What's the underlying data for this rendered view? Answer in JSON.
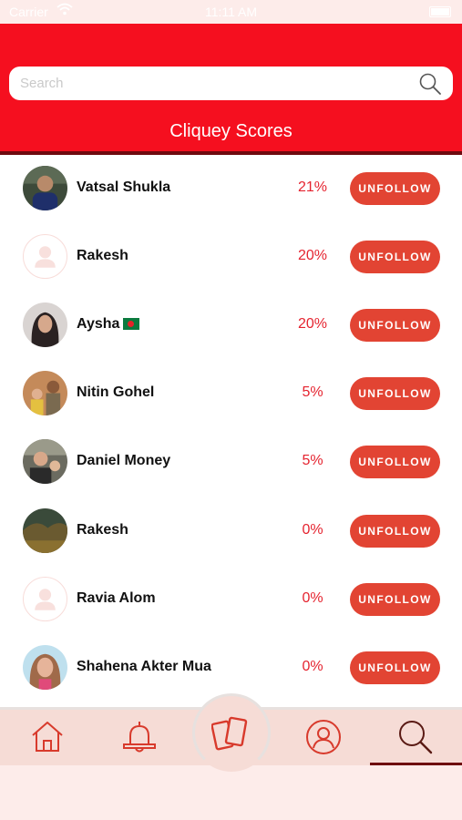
{
  "status_bar": {
    "carrier": "Carrier",
    "time": "11:11 AM"
  },
  "header": {
    "search_placeholder": "Search",
    "title": "Cliquey Scores",
    "color": "#f50f1f"
  },
  "button_color": "#e24433",
  "rows": [
    {
      "name": "Vatsal Shukla",
      "flag": false,
      "percent": "21%",
      "button": "UNFOLLOW",
      "avatar": "photo"
    },
    {
      "name": "Rakesh",
      "flag": false,
      "percent": "20%",
      "button": "UNFOLLOW",
      "avatar": "placeholder"
    },
    {
      "name": "Aysha",
      "flag": true,
      "percent": "20%",
      "button": "UNFOLLOW",
      "avatar": "photo"
    },
    {
      "name": "Nitin Gohel",
      "flag": false,
      "percent": "5%",
      "button": "UNFOLLOW",
      "avatar": "photo"
    },
    {
      "name": "Daniel Money",
      "flag": false,
      "percent": "5%",
      "button": "UNFOLLOW",
      "avatar": "photo"
    },
    {
      "name": "Rakesh",
      "flag": false,
      "percent": "0%",
      "button": "UNFOLLOW",
      "avatar": "photo"
    },
    {
      "name": "Ravia Alom",
      "flag": false,
      "percent": "0%",
      "button": "UNFOLLOW",
      "avatar": "placeholder"
    },
    {
      "name": "Shahena Akter Mua",
      "flag": false,
      "percent": "0%",
      "button": "UNFOLLOW",
      "avatar": "photo"
    }
  ],
  "tabbar": {
    "tabs": [
      {
        "icon": "home-icon"
      },
      {
        "icon": "bell-icon"
      },
      {
        "icon": "cards-icon"
      },
      {
        "icon": "profile-icon"
      },
      {
        "icon": "search-icon"
      }
    ],
    "active": "search"
  }
}
